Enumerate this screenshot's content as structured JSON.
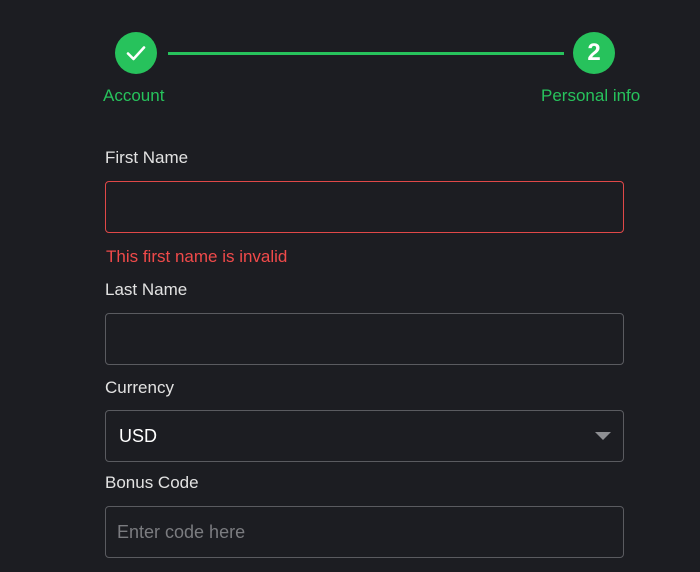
{
  "stepper": {
    "steps": [
      {
        "label": "Account",
        "state": "complete",
        "icon": "check-icon"
      },
      {
        "label": "Personal info",
        "number": "2",
        "state": "active"
      }
    ],
    "accent_color": "#27c25c"
  },
  "form": {
    "first_name": {
      "label": "First Name",
      "value": "",
      "error": "This first name is invalid"
    },
    "last_name": {
      "label": "Last Name",
      "value": ""
    },
    "currency": {
      "label": "Currency",
      "selected": "USD"
    },
    "bonus_code": {
      "label": "Bonus Code",
      "placeholder": "Enter code here",
      "value": ""
    },
    "error_color": "#f04a4a"
  }
}
